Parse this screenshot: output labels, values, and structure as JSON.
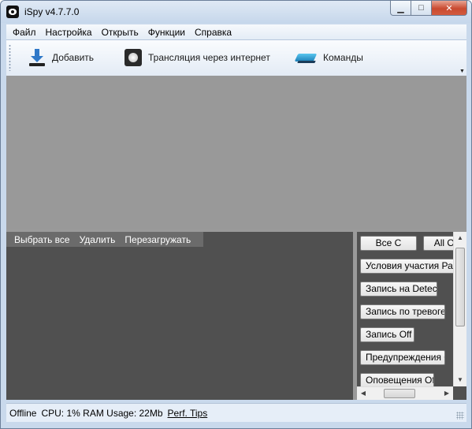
{
  "window": {
    "title": "iSpy v4.7.7.0"
  },
  "menu": {
    "items": [
      "Файл",
      "Настройка",
      "Открыть",
      "Функции",
      "Справка"
    ]
  },
  "toolbar": {
    "items": [
      {
        "label": "Добавить",
        "icon": "add-download-icon"
      },
      {
        "label": "Трансляция через интернет",
        "icon": "webcam-icon"
      },
      {
        "label": "Команды",
        "icon": "commands-icon"
      }
    ]
  },
  "media": {
    "actions": [
      "Выбрать все",
      "Удалить",
      "Перезагружать"
    ]
  },
  "commands": {
    "buttons": [
      "Все С",
      "All Off",
      "Условия участия Распознавание",
      "Запись на Detect",
      "Запись по тревоге",
      "Запись Off",
      "Предупреждения С",
      "Оповещения Off"
    ]
  },
  "status": {
    "state": "Offline",
    "usage": "CPU: 1% RAM Usage: 22Mb",
    "perf_link": "Perf. Tips"
  }
}
